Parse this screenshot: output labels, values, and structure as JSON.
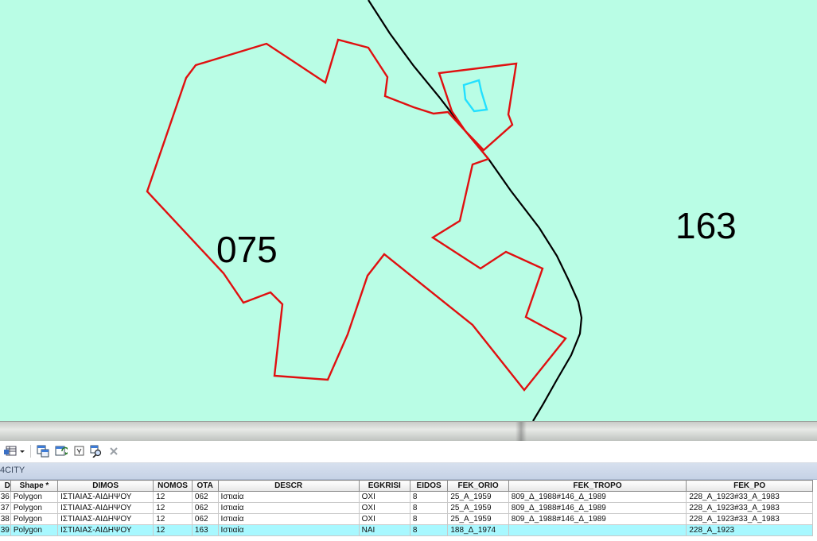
{
  "map": {
    "labels": {
      "parcel_075": "075",
      "parcel_163": "163"
    },
    "colors": {
      "background": "#b9fde5",
      "parcel_outline": "#e01010",
      "selected_outline": "#22e0ff",
      "boundary_line": "#000000"
    }
  },
  "toolbar": {
    "buttons": [
      "table-options-icon",
      "select-by-attributes-icon",
      "switch-selection-icon",
      "clear-selection-icon",
      "zoom-to-selected-icon",
      "delete-selected-icon"
    ]
  },
  "table_title": "4CITY",
  "table": {
    "columns": [
      "D",
      "Shape *",
      "DIMOS",
      "NOMOS",
      "OTA",
      "DESCR",
      "EGKRISI",
      "EIDOS",
      "FEK_ORIO",
      "FEK_TROPO",
      "FEK_PO"
    ],
    "rows": [
      {
        "fid": "36",
        "shape": "Polygon",
        "dimos": "ΙΣΤΙΑΙΑΣ-ΑΙΔΗΨΟΥ",
        "nomos": "12",
        "ota": "062",
        "descr": "Ιστιαία",
        "egkrisi": "ΟΧΙ",
        "eidos": "8",
        "fek_orio": "25_A_1959",
        "fek_tropo": "809_Δ_1988#146_Δ_1989",
        "fek_po": "228_A_1923#33_A_1983"
      },
      {
        "fid": "37",
        "shape": "Polygon",
        "dimos": "ΙΣΤΙΑΙΑΣ-ΑΙΔΗΨΟΥ",
        "nomos": "12",
        "ota": "062",
        "descr": "Ιστιαία",
        "egkrisi": "ΟΧΙ",
        "eidos": "8",
        "fek_orio": "25_A_1959",
        "fek_tropo": "809_Δ_1988#146_Δ_1989",
        "fek_po": "228_A_1923#33_A_1983"
      },
      {
        "fid": "38",
        "shape": "Polygon",
        "dimos": "ΙΣΤΙΑΙΑΣ-ΑΙΔΗΨΟΥ",
        "nomos": "12",
        "ota": "062",
        "descr": "Ιστιαία",
        "egkrisi": "ΟΧΙ",
        "eidos": "8",
        "fek_orio": "25_A_1959",
        "fek_tropo": "809_Δ_1988#146_Δ_1989",
        "fek_po": "228_A_1923#33_A_1983"
      },
      {
        "fid": "39",
        "shape": "Polygon",
        "dimos": "ΙΣΤΙΑΙΑΣ-ΑΙΔΗΨΟΥ",
        "nomos": "12",
        "ota": "163",
        "descr": "Ιστιαία",
        "egkrisi": "ΝΑΙ",
        "eidos": "8",
        "fek_orio": "188_Δ_1974",
        "fek_tropo": "",
        "fek_po": "228_A_1923"
      }
    ]
  }
}
